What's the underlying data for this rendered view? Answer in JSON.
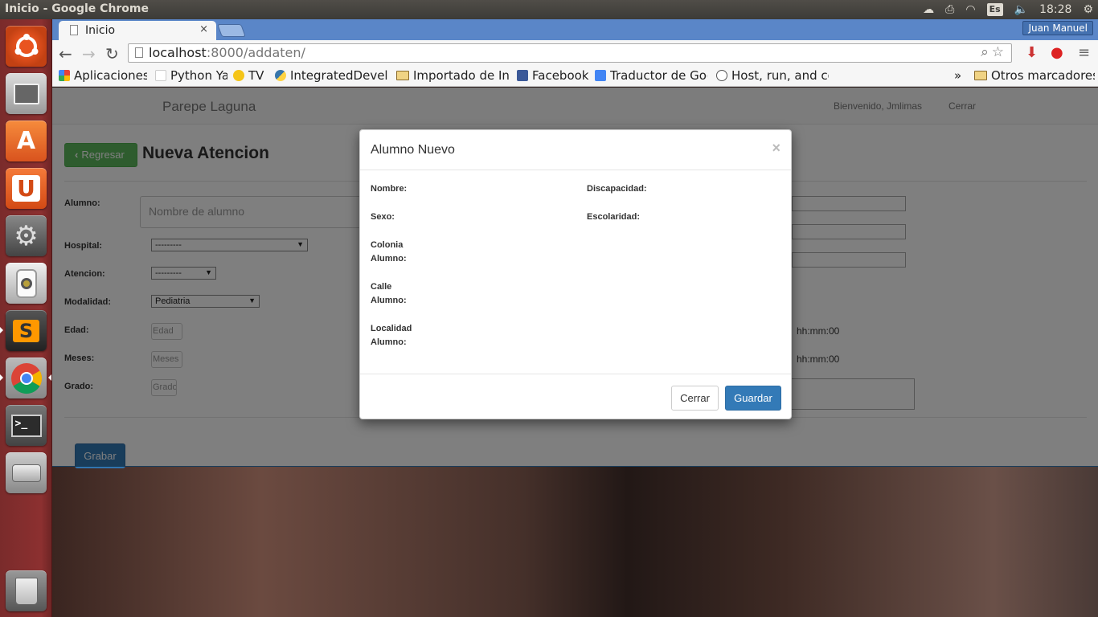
{
  "os": {
    "window_title": "Inicio - Google Chrome",
    "keyboard_layout": "Es",
    "clock": "18:28",
    "tray_icons": [
      "cloud-icon",
      "printer-icon",
      "wifi-icon",
      "keyboard-layout-icon",
      "volume-icon",
      "gear-icon"
    ]
  },
  "launcher": {
    "items": [
      "ubuntu-dash-icon",
      "files-icon",
      "software-center-icon",
      "ubuntu-one-icon",
      "system-settings-icon",
      "audio-player-icon",
      "sublime-text-icon",
      "chrome-icon",
      "terminal-icon",
      "disk-icon",
      "trash-icon"
    ],
    "sublime_letter": "S",
    "ubuntu_one_letter": "U",
    "terminal_prompt": ">_"
  },
  "browser": {
    "tab_title": "Inicio",
    "tab_close": "×",
    "profile_name": "Juan Manuel",
    "url_host": "localhost",
    "url_rest": ":8000/addaten/",
    "bookmarks": [
      {
        "label": "Aplicaciones",
        "color": "#e94235"
      },
      {
        "label": "Python Ya",
        "color": "#ffffff"
      },
      {
        "label": "TV",
        "color": "#f5c518"
      },
      {
        "label": "IntegratedDevelo",
        "color": "#3776ab"
      },
      {
        "label": "Importado de Inte",
        "color": "folder"
      },
      {
        "label": "Facebook",
        "color": "#3b5998"
      },
      {
        "label": "Traductor de Goo",
        "color": "#4285f4"
      },
      {
        "label": "Host, run, and co",
        "color": "#ffffff"
      }
    ],
    "bookmarks_overflow": "»",
    "other_bookmarks": "Otros marcadores"
  },
  "navbar": {
    "brand": "Parepe Laguna",
    "welcome": "Bienvenido, Jmlimas",
    "logout": "Cerrar"
  },
  "form": {
    "back_label": "Regresar",
    "back_icon": "‹",
    "title": "Nueva Atencion",
    "alumno_label": "Alumno:",
    "alumno_placeholder": "Nombre de alumno",
    "hospital_label": "Hospital:",
    "hospital_value": "---------",
    "atencion_label": "Atencion:",
    "atencion_value": "---------",
    "modalidad_label": "Modalidad:",
    "modalidad_value": "Pediatria",
    "edad_label": "Edad:",
    "edad_placeholder": "Edad",
    "meses_label": "Meses:",
    "meses_placeholder": "Meses",
    "grado_label": "Grado:",
    "grado_placeholder": "Grado",
    "time_format_1": "hh:mm:00",
    "time_format_2": "hh:mm:00",
    "save_label": "Grabar"
  },
  "modal": {
    "title": "Alumno Nuevo",
    "close": "×",
    "left_fields": [
      "Nombre:",
      "Sexo:",
      "Colonia\nAlumno:",
      "Calle\nAlumno:",
      "Localidad\nAlumno:"
    ],
    "right_fields": [
      "Discapacidad:",
      "Escolaridad:"
    ],
    "cancel_label": "Cerrar",
    "confirm_label": "Guardar"
  },
  "colors": {
    "primary": "#337ab7",
    "success": "#5cb85c",
    "chrome_tabstrip": "#5a86c8",
    "launcher": "#8c3030"
  }
}
